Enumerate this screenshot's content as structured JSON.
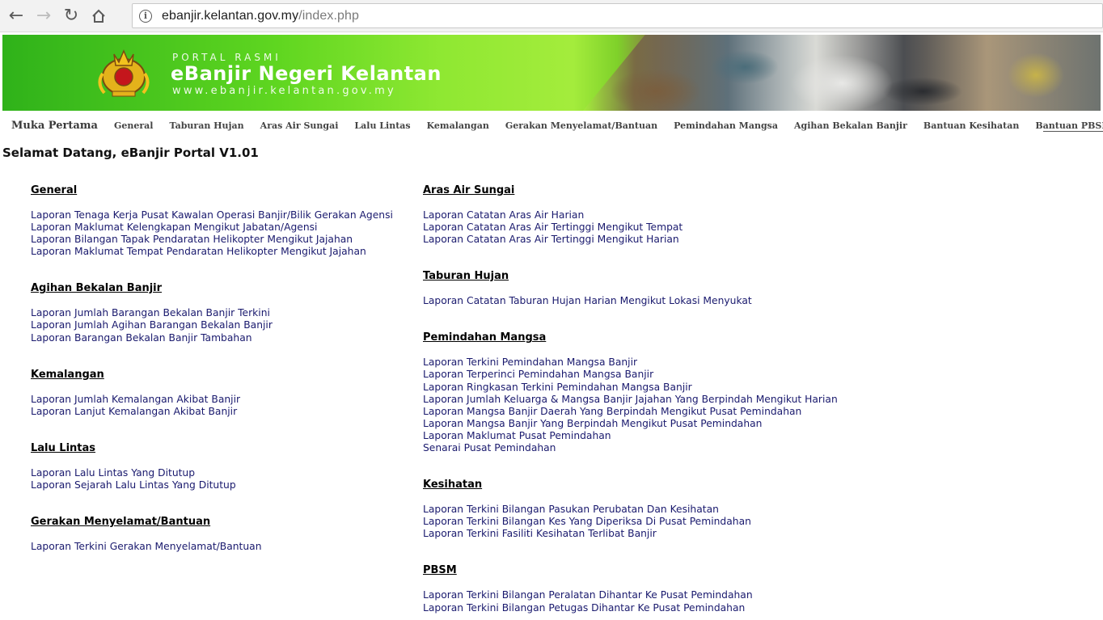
{
  "browser": {
    "url_host": "ebanjir.kelantan.gov.my",
    "url_path": "/index.php"
  },
  "banner": {
    "small_text": "PORTAL RASMI",
    "title": "eBanjir Negeri Kelantan",
    "url_text": "www.ebanjir.kelantan.gov.my"
  },
  "menu": [
    "Muka Pertama",
    "General",
    "Taburan Hujan",
    "Aras Air Sungai",
    "Lalu Lintas",
    "Kemalangan",
    "Gerakan Menyelamat/Bantuan",
    "Pemindahan Mangsa",
    "Agihan Bekalan Banjir",
    "Bantuan Kesihatan",
    "Bantuan PBSM"
  ],
  "welcome": "Selamat Datang, eBanjir Portal V1.01",
  "left_sections": [
    {
      "title": "General",
      "links": [
        "Laporan Tenaga Kerja Pusat Kawalan Operasi Banjir/Bilik Gerakan Agensi",
        "Laporan Maklumat Kelengkapan Mengikut Jabatan/Agensi",
        "Laporan Bilangan Tapak Pendaratan Helikopter Mengikut Jajahan",
        "Laporan Maklumat Tempat Pendaratan Helikopter Mengikut Jajahan"
      ]
    },
    {
      "title": "Agihan Bekalan Banjir",
      "links": [
        "Laporan Jumlah Barangan Bekalan Banjir Terkini",
        "Laporan Jumlah Agihan Barangan Bekalan Banjir",
        "Laporan Barangan Bekalan Banjir Tambahan"
      ]
    },
    {
      "title": "Kemalangan",
      "links": [
        "Laporan Jumlah Kemalangan Akibat Banjir",
        "Laporan Lanjut Kemalangan Akibat Banjir"
      ]
    },
    {
      "title": "Lalu Lintas",
      "links": [
        "Laporan Lalu Lintas Yang Ditutup",
        "Laporan Sejarah Lalu Lintas Yang Ditutup"
      ]
    },
    {
      "title": "Gerakan Menyelamat/Bantuan",
      "links": [
        "Laporan Terkini Gerakan Menyelamat/Bantuan"
      ]
    }
  ],
  "right_sections": [
    {
      "title": "Aras Air Sungai",
      "links": [
        "Laporan Catatan Aras Air Harian",
        "Laporan Catatan Aras Air Tertinggi Mengikut Tempat",
        "Laporan Catatan Aras Air Tertinggi Mengikut Harian"
      ]
    },
    {
      "title": "Taburan Hujan",
      "links": [
        "Laporan Catatan Taburan Hujan Harian Mengikut Lokasi Menyukat"
      ]
    },
    {
      "title": "Pemindahan Mangsa",
      "links": [
        "Laporan Terkini Pemindahan Mangsa Banjir",
        "Laporan Terperinci Pemindahan Mangsa Banjir",
        "Laporan Ringkasan Terkini Pemindahan Mangsa Banjir",
        "Laporan Jumlah Keluarga & Mangsa Banjir Jajahan Yang Berpindah Mengikut Harian",
        "Laporan Mangsa Banjir Daerah Yang Berpindah Mengikut Pusat Pemindahan",
        "Laporan Mangsa Banjir Yang Berpindah Mengikut Pusat Pemindahan",
        "Laporan Maklumat Pusat Pemindahan",
        "Senarai Pusat Pemindahan"
      ]
    },
    {
      "title": "Kesihatan",
      "links": [
        "Laporan Terkini Bilangan Pasukan Perubatan Dan Kesihatan",
        "Laporan Terkini Bilangan Kes Yang Diperiksa Di Pusat Pemindahan",
        "Laporan Terkini Fasiliti Kesihatan Terlibat Banjir"
      ]
    },
    {
      "title": "PBSM",
      "links": [
        "Laporan Terkini Bilangan Peralatan Dihantar Ke Pusat Pemindahan",
        "Laporan Terkini Bilangan Petugas Dihantar Ke Pusat Pemindahan"
      ]
    }
  ]
}
